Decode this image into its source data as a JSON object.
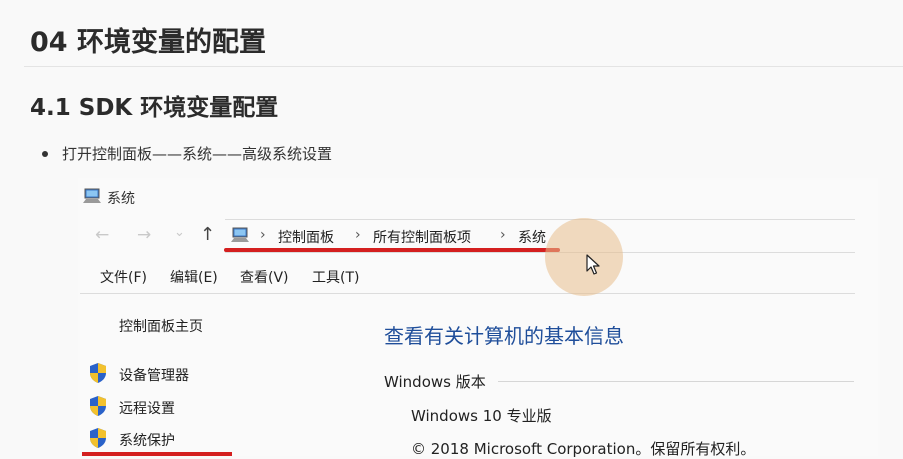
{
  "doc": {
    "heading_main": "04 环境变量的配置",
    "heading_sub": "4.1 SDK 环境变量配置",
    "bullet": "打开控制面板——系统——高级系统设置"
  },
  "window": {
    "title": "系统",
    "nav": {
      "back": "←",
      "forward": "→",
      "recent": "⌄",
      "up": "↑"
    },
    "breadcrumb": [
      "控制面板",
      "所有控制面板项",
      "系统"
    ],
    "breadcrumb_sep": "›",
    "menu": [
      "文件(F)",
      "编辑(E)",
      "查看(V)",
      "工具(T)"
    ],
    "sidebar": {
      "home": "控制面板主页",
      "items": [
        "设备管理器",
        "远程设置",
        "系统保护"
      ]
    },
    "main": {
      "title": "查看有关计算机的基本信息",
      "section": "Windows 版本",
      "edition": "Windows 10 专业版",
      "copyright": "© 2018 Microsoft Corporation。保留所有权利。"
    }
  },
  "colors": {
    "highlight_red": "#d41f1f",
    "link_blue": "#1f4e9a",
    "cursor_halo": "#e8be8c",
    "shield_blue": "#2a62c9",
    "shield_yellow": "#f2c12e"
  },
  "icons": {
    "computer": "computer-icon",
    "shield": "uac-shield-icon",
    "cursor": "mouse-cursor-icon"
  }
}
